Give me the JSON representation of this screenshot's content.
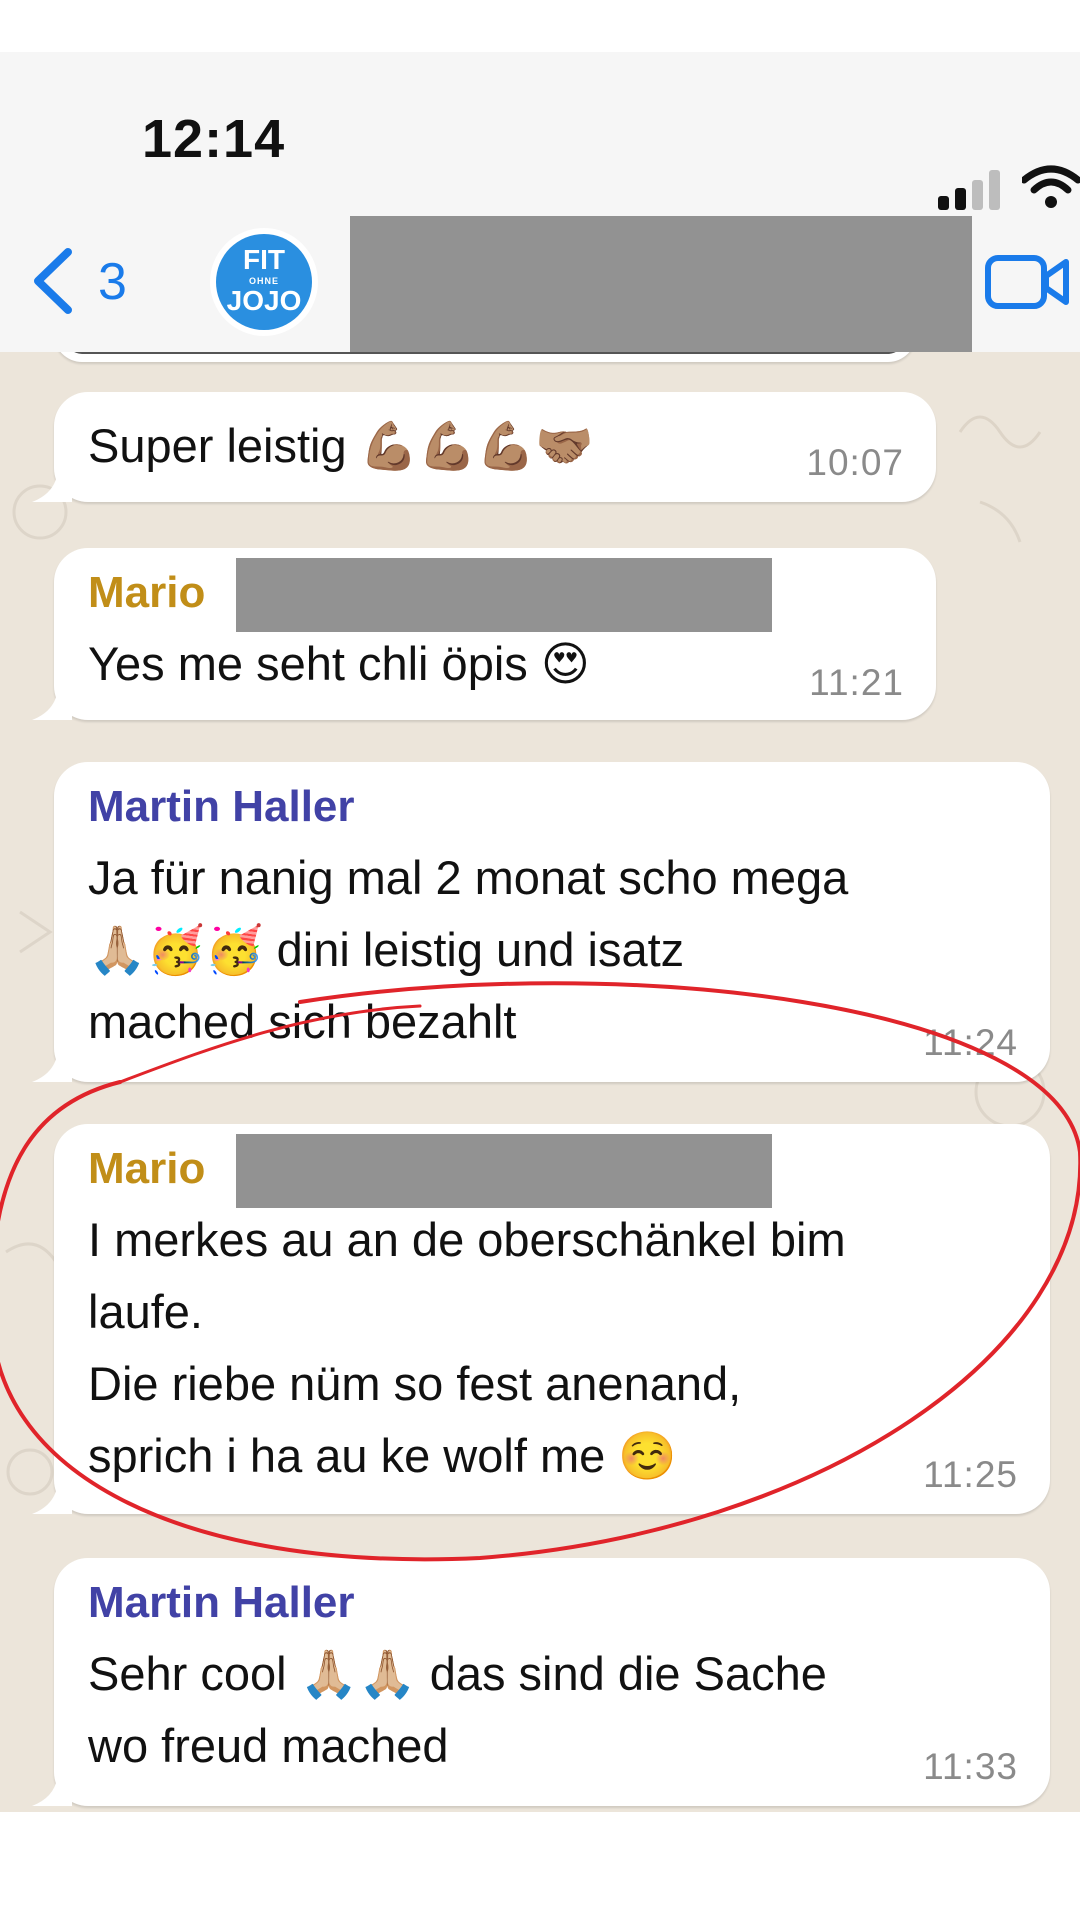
{
  "status_bar": {
    "time": "12:14",
    "icons": [
      "cellular-signal-icon",
      "wifi-icon"
    ]
  },
  "nav": {
    "back_count": "3",
    "avatar": {
      "line1": "FIT",
      "line2": "OHNE",
      "line3": "JOJO"
    },
    "title_redacted": true,
    "icons": [
      "back-chevron-icon",
      "video-call-icon"
    ],
    "accent": "#1a7bea"
  },
  "chat": {
    "background": "#ece5da",
    "messages": [
      {
        "text": "Super leistig 💪🏽💪🏽💪🏽🤝🏽",
        "time": "10:07"
      },
      {
        "sender": "Mario",
        "sender_redacted": true,
        "text": "Yes me seht chli öpis 😍",
        "time": "11:21"
      },
      {
        "sender": "Martin Haller",
        "text": "Ja für nanig mal 2 monat scho mega\n🙏🏼🥳🥳 dini leistig und isatz\nmached sich bezahlt",
        "time": "11:24"
      },
      {
        "sender": "Mario",
        "sender_redacted": true,
        "text": "I merkes au an de oberschänkel bim\nlaufe.\nDie riebe nüm so fest anenand,\nsprich i ha au ke wolf me ☺️",
        "time": "11:25"
      },
      {
        "sender": "Martin Haller",
        "text": "Sehr cool 🙏🏼🙏🏼 das sind die Sache\nwo freud mached",
        "time": "11:33"
      }
    ],
    "colors": {
      "mario": "#c18e18",
      "martin": "#4142a6",
      "annotation": "#e0242a"
    }
  }
}
